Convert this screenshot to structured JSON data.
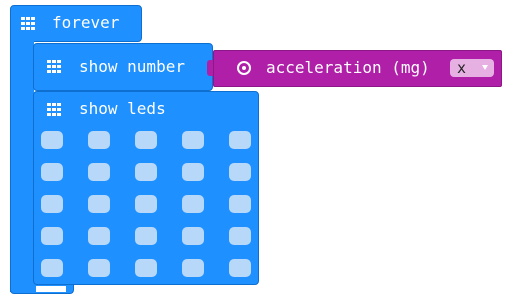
{
  "forever": {
    "label": "forever",
    "icon": "grid-icon"
  },
  "show_number": {
    "label": "show number",
    "icon": "grid-icon"
  },
  "acceleration": {
    "label": "acceleration (mg)",
    "icon": "target-icon",
    "dimension": {
      "selected": "x",
      "icon": "chevron-down-icon"
    }
  },
  "show_leds": {
    "label": "show leds",
    "icon": "grid-icon"
  },
  "leds": {
    "rows": 5,
    "cols": 5,
    "states": [
      [
        false,
        false,
        false,
        false,
        false
      ],
      [
        false,
        false,
        false,
        false,
        false
      ],
      [
        false,
        false,
        false,
        false,
        false
      ],
      [
        false,
        false,
        false,
        false,
        false
      ],
      [
        false,
        false,
        false,
        false,
        false
      ]
    ]
  },
  "colors": {
    "basic_block": "#1e90ff",
    "input_block": "#b01fa8",
    "led_off": "#b8d8fa",
    "led_on": "#ffffff",
    "dropdown_bg": "#e6b0e2"
  }
}
